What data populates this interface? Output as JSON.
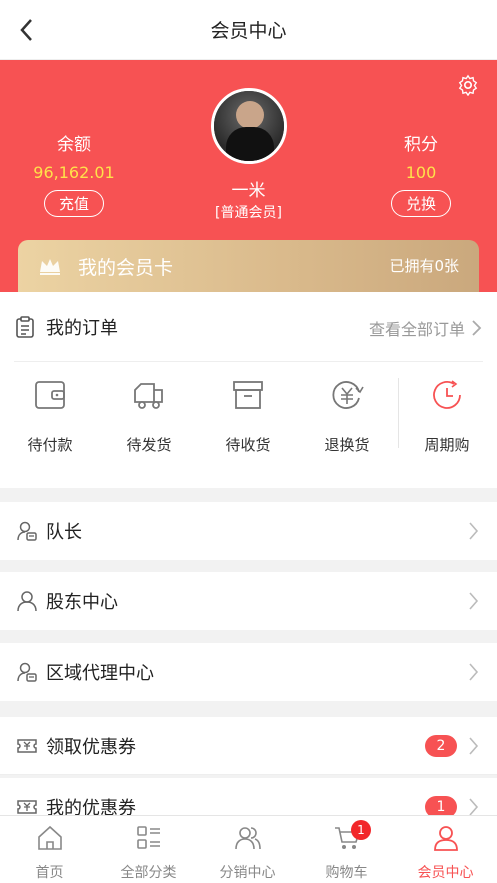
{
  "navbar": {
    "title": "会员中心"
  },
  "profile": {
    "balance_label": "余额",
    "balance_value": "96,162.01",
    "recharge_label": "充值",
    "points_label": "积分",
    "points_value": "100",
    "exchange_label": "兑换",
    "username": "一米",
    "level": "[普通会员]"
  },
  "member_card": {
    "title": "我的会员卡",
    "count": "已拥有0张"
  },
  "orders": {
    "title": "我的订单",
    "view_all": "查看全部订单",
    "items": [
      {
        "label": "待付款",
        "icon": "wallet-icon"
      },
      {
        "label": "待发货",
        "icon": "truck-icon"
      },
      {
        "label": "待收货",
        "icon": "box-icon"
      },
      {
        "label": "退换货",
        "icon": "refund-icon"
      },
      {
        "label": "周期购",
        "icon": "clock-icon"
      }
    ]
  },
  "menu": {
    "captain": "队长",
    "shareholder": "股东中心",
    "region_agent": "区域代理中心",
    "get_coupons": "领取优惠券",
    "get_coupons_badge": "2",
    "my_coupons": "我的优惠券",
    "my_coupons_badge": "1"
  },
  "tabbar": {
    "items": [
      {
        "label": "首页",
        "icon": "home-icon"
      },
      {
        "label": "全部分类",
        "icon": "category-icon"
      },
      {
        "label": "分销中心",
        "icon": "people-icon"
      },
      {
        "label": "购物车",
        "icon": "cart-icon"
      },
      {
        "label": "会员中心",
        "icon": "user-icon"
      }
    ],
    "cart_badge": "1"
  },
  "colors": {
    "primary": "#f75253",
    "gold": "#ffe24a",
    "card_gold": "#d9b98b"
  }
}
